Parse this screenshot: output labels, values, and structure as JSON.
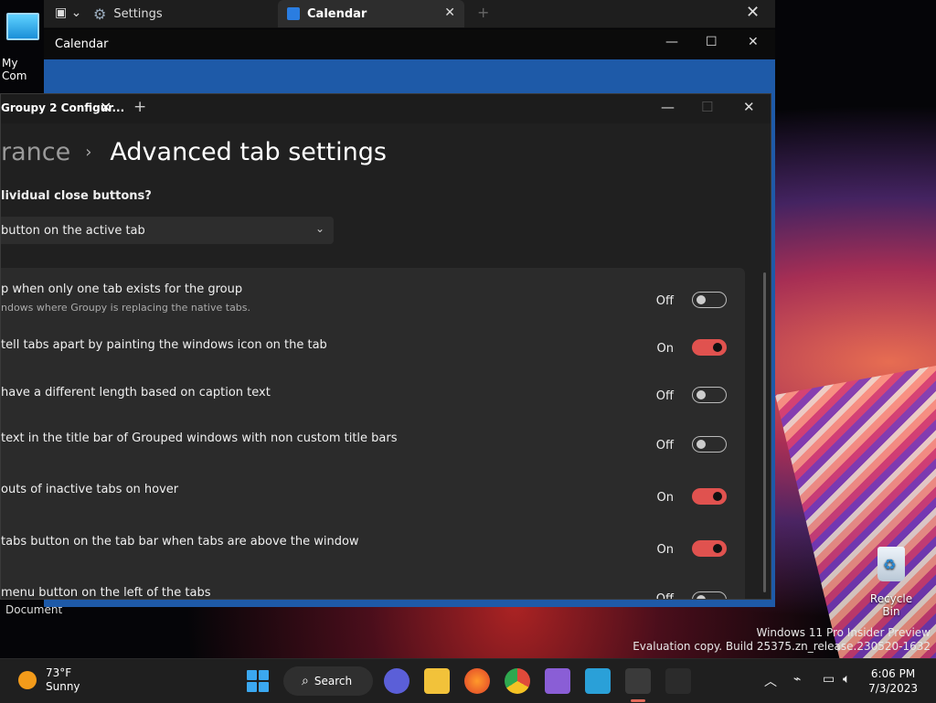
{
  "desktop": {
    "pc_label": "My Com",
    "doc_label": "Document",
    "recycle_label": "Recycle Bin",
    "watermark_line1": "Windows 11 Pro Insider Preview",
    "watermark_line2": "Evaluation copy. Build 25375.zn_release.230520-1632"
  },
  "topbar": {
    "tabs": [
      {
        "label": "Settings",
        "icon": "gear-icon"
      },
      {
        "label": "Calendar",
        "icon": "calendar-icon"
      }
    ],
    "tab_close": "✕",
    "new_tab": "+",
    "close": "✕"
  },
  "calendar_window": {
    "title": "Calendar",
    "minimize": "—",
    "maximize": "☐",
    "close": "✕"
  },
  "config_window": {
    "tab_title": "Groupy 2 Configur...",
    "tab_close": "✕",
    "new_tab": "+",
    "minimize": "—",
    "maximize": "☐",
    "close": "✕",
    "breadcrumb_prev": "rance",
    "breadcrumb_sep": "›",
    "page_title": "Advanced tab settings",
    "question": "lividual close buttons?",
    "dropdown_value": "button on the active tab",
    "settings": [
      {
        "label": "p when only one tab exists for the group",
        "sub": "ndows where Groupy is replacing the native tabs.",
        "state": "Off",
        "on": false
      },
      {
        "label": "tell tabs apart by painting the windows icon on the tab",
        "sub": "",
        "state": "On",
        "on": true
      },
      {
        "label": "  have a different length based on caption text",
        "sub": "",
        "state": "Off",
        "on": false
      },
      {
        "label": "text in the title bar of Grouped windows with non custom title bars",
        "sub": "",
        "state": "Off",
        "on": false
      },
      {
        "label": "outs of inactive tabs on hover",
        "sub": "",
        "state": "On",
        "on": true
      },
      {
        "label": "tabs button on the tab bar when tabs are above the window",
        "sub": "",
        "state": "On",
        "on": true
      },
      {
        "label": "menu button on the left of the tabs",
        "sub": "",
        "state": "Off",
        "on": false
      }
    ]
  },
  "taskbar": {
    "weather_temp": "73°F",
    "weather_desc": "Sunny",
    "search_label": "Search",
    "time": "6:06 PM",
    "date": "7/3/2023"
  },
  "colors": {
    "toggle_on": "#e0524f",
    "accent": "#3ba8f0"
  }
}
